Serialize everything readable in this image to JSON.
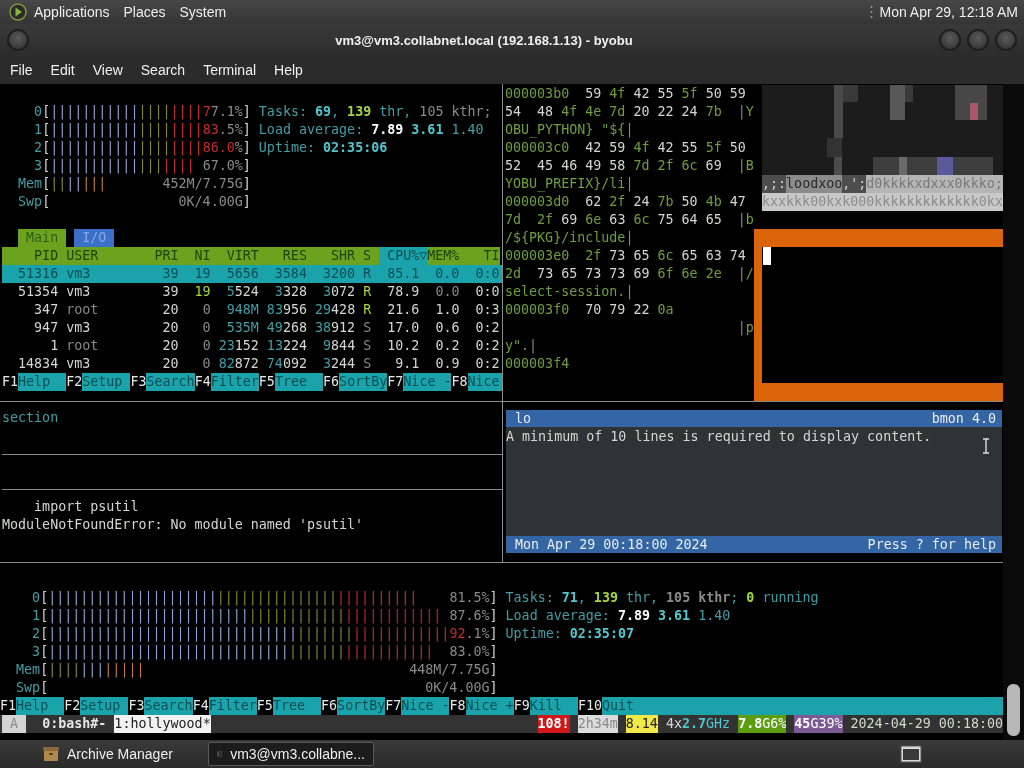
{
  "top_panel": {
    "menus": [
      "Applications",
      "Places",
      "System"
    ],
    "clock": "Mon Apr 29, 12:18 AM"
  },
  "window": {
    "title": "vm3@vm3.collabnet.local (192.168.1.13) - byobu"
  },
  "menu_bar": [
    "File",
    "Edit",
    "View",
    "Search",
    "Terminal",
    "Help"
  ],
  "htop_top": {
    "meters": [
      {
        "segs": [
          {
            "text": "    0",
            "kind": "label"
          },
          {
            "text": "[",
            "kind": "text"
          },
          {
            "text": "|||||||||||",
            "kind": "bar_low"
          },
          {
            "text": "||||",
            "kind": "bar_mid"
          },
          {
            "text": "||||7",
            "kind": "bar_high"
          },
          {
            "text": "7.1%",
            "kind": "dim"
          },
          {
            "text": "]",
            "kind": "text"
          },
          {
            "text": " Tasks:",
            "kind": "label"
          },
          {
            "text": " 69",
            "kind": "num"
          },
          {
            "text": ",",
            "kind": "label"
          },
          {
            "text": " 139",
            "kind": "count"
          },
          {
            "text": " thr,",
            "kind": "label"
          },
          {
            "text": " 105 kthr;",
            "kind": "dim"
          }
        ]
      },
      {
        "segs": [
          {
            "text": "    1",
            "kind": "label"
          },
          {
            "text": "[",
            "kind": "text"
          },
          {
            "text": "|||||||||||",
            "kind": "bar_low"
          },
          {
            "text": "||||",
            "kind": "bar_mid"
          },
          {
            "text": "||||83",
            "kind": "bar_high"
          },
          {
            "text": ".5%",
            "kind": "dim"
          },
          {
            "text": "]",
            "kind": "text"
          },
          {
            "text": " Load average:",
            "kind": "label"
          },
          {
            "text": " 7.89",
            "kind": "strong"
          },
          {
            "text": " 3.61",
            "kind": "num"
          },
          {
            "text": " 1.40",
            "kind": "label"
          }
        ]
      },
      {
        "segs": [
          {
            "text": "    2",
            "kind": "label"
          },
          {
            "text": "[",
            "kind": "text"
          },
          {
            "text": "|||||||||||",
            "kind": "bar_low"
          },
          {
            "text": "||||",
            "kind": "bar_mid"
          },
          {
            "text": "||||86.0",
            "kind": "bar_high"
          },
          {
            "text": "%",
            "kind": "dim"
          },
          {
            "text": "]",
            "kind": "text"
          },
          {
            "text": " Uptime:",
            "kind": "label"
          },
          {
            "text": " 02:35:06",
            "kind": "num"
          }
        ]
      },
      {
        "segs": [
          {
            "text": "    3",
            "kind": "label"
          },
          {
            "text": "[",
            "kind": "text"
          },
          {
            "text": "|||||||||||",
            "kind": "bar_low"
          },
          {
            "text": "|||",
            "kind": "bar_mid"
          },
          {
            "text": "||||",
            "kind": "bar_high"
          },
          {
            "text": " 67.0%",
            "kind": "dim"
          },
          {
            "text": "]",
            "kind": "text"
          }
        ]
      },
      {
        "segs": [
          {
            "text": "  Mem",
            "kind": "label"
          },
          {
            "text": "[",
            "kind": "text"
          },
          {
            "text": "||",
            "kind": "bar_mid"
          },
          {
            "text": "||",
            "kind": "bar_low"
          },
          {
            "text": "|||",
            "kind": "bar_buf"
          },
          {
            "text": "       452M/7.75G",
            "kind": "dim"
          },
          {
            "text": "]",
            "kind": "text"
          }
        ]
      },
      {
        "segs": [
          {
            "text": "  Swp",
            "kind": "label"
          },
          {
            "text": "[",
            "kind": "text"
          },
          {
            "text": "                0K/4.00G",
            "kind": "dim"
          },
          {
            "text": "]",
            "kind": "text"
          }
        ]
      }
    ],
    "tabs": [
      {
        "label": "Main",
        "selected": true
      },
      {
        "label": "I/O",
        "selected": false
      }
    ],
    "header": [
      {
        "text": "    PID USER       PRI  NI  VIRT   RES   SHR S ",
        "kind": "header"
      },
      {
        "text": " CPU%▽",
        "kind": "sorted"
      },
      {
        "text": "MEM%   TI",
        "kind": "header"
      }
    ],
    "processes": [
      {
        "selected": true,
        "segs": [
          {
            "text": "  51316 vm3         39  19  5656  3584  3200 R  85.1  0.0  0:0",
            "kind": "text"
          }
        ]
      },
      {
        "selected": false,
        "segs": [
          {
            "text": "  51354 vm3         39  ",
            "kind": "text"
          },
          {
            "text": "19",
            "kind": "ok"
          },
          {
            "text": "  5",
            "kind": "thousands"
          },
          {
            "text": "524  ",
            "kind": "text"
          },
          {
            "text": "3",
            "kind": "thousands"
          },
          {
            "text": "328  ",
            "kind": "text"
          },
          {
            "text": "3",
            "kind": "thousands"
          },
          {
            "text": "072 ",
            "kind": "text"
          },
          {
            "text": "R",
            "kind": "ok"
          },
          {
            "text": "  78.9  ",
            "kind": "text"
          },
          {
            "text": "0.0",
            "kind": "dim"
          },
          {
            "text": "  0:0",
            "kind": "text"
          }
        ]
      },
      {
        "selected": false,
        "segs": [
          {
            "text": "    347 ",
            "kind": "text"
          },
          {
            "text": "root",
            "kind": "dim"
          },
          {
            "text": "        20   ",
            "kind": "text"
          },
          {
            "text": "0",
            "kind": "dim"
          },
          {
            "text": "  948M",
            "kind": "thousands"
          },
          {
            "text": " 83",
            "kind": "thousands"
          },
          {
            "text": "956 ",
            "kind": "text"
          },
          {
            "text": "29",
            "kind": "thousands"
          },
          {
            "text": "428 ",
            "kind": "text"
          },
          {
            "text": "R",
            "kind": "ok"
          },
          {
            "text": "  21.6  1.0  0:3",
            "kind": "text"
          }
        ]
      },
      {
        "selected": false,
        "segs": [
          {
            "text": "    947 vm3         20   ",
            "kind": "text"
          },
          {
            "text": "0",
            "kind": "dim"
          },
          {
            "text": "  535M",
            "kind": "thousands"
          },
          {
            "text": " 49",
            "kind": "thousands"
          },
          {
            "text": "268 ",
            "kind": "text"
          },
          {
            "text": "38",
            "kind": "thousands"
          },
          {
            "text": "912 ",
            "kind": "text"
          },
          {
            "text": "S",
            "kind": "dim"
          },
          {
            "text": "  17.0  0.6  0:2",
            "kind": "text"
          }
        ]
      },
      {
        "selected": false,
        "segs": [
          {
            "text": "      1 ",
            "kind": "text"
          },
          {
            "text": "root",
            "kind": "dim"
          },
          {
            "text": "        20   ",
            "kind": "text"
          },
          {
            "text": "0",
            "kind": "dim"
          },
          {
            "text": " 23",
            "kind": "thousands"
          },
          {
            "text": "152 ",
            "kind": "text"
          },
          {
            "text": "13",
            "kind": "thousands"
          },
          {
            "text": "224  ",
            "kind": "text"
          },
          {
            "text": "9",
            "kind": "thousands"
          },
          {
            "text": "844 ",
            "kind": "text"
          },
          {
            "text": "S",
            "kind": "dim"
          },
          {
            "text": "  10.2  0.2  0:2",
            "kind": "text"
          }
        ]
      },
      {
        "selected": false,
        "segs": [
          {
            "text": "  14834 vm3         20   ",
            "kind": "text"
          },
          {
            "text": "0",
            "kind": "dim"
          },
          {
            "text": " 82",
            "kind": "thousands"
          },
          {
            "text": "872 ",
            "kind": "text"
          },
          {
            "text": "74",
            "kind": "thousands"
          },
          {
            "text": "092  ",
            "kind": "text"
          },
          {
            "text": "3",
            "kind": "thousands"
          },
          {
            "text": "244 ",
            "kind": "text"
          },
          {
            "text": "S",
            "kind": "dim"
          },
          {
            "text": "   9.1  0.9  0:2",
            "kind": "text"
          }
        ]
      }
    ],
    "keys": [
      {
        "key": "F1",
        "label": "Help"
      },
      {
        "key": "F2",
        "label": "Setup"
      },
      {
        "key": "F3",
        "label": "Search"
      },
      {
        "key": "F4",
        "label": "Filter"
      },
      {
        "key": "F5",
        "label": "Tree"
      },
      {
        "key": "F6",
        "label": "SortBy"
      },
      {
        "key": "F7",
        "label": "Nice -"
      },
      {
        "key": "F8",
        "label": "Nice"
      }
    ]
  },
  "hex_dump": {
    "lines": [
      {
        "segs": [
          {
            "text": "000003b0",
            "kind": "hex"
          },
          {
            "text": "  59 ",
            "kind": "text"
          },
          {
            "text": "4f",
            "kind": "hex"
          },
          {
            "text": " 42 55 ",
            "kind": "text"
          },
          {
            "text": "5f",
            "kind": "hex"
          },
          {
            "text": " 50 59",
            "kind": "text"
          }
        ]
      },
      {
        "segs": [
          {
            "text": "54  48 ",
            "kind": "text"
          },
          {
            "text": "4f 4e 7d",
            "kind": "hex"
          },
          {
            "text": " 20 22 24 ",
            "kind": "text"
          },
          {
            "text": "7b",
            "kind": "hex"
          },
          {
            "text": "  |",
            "kind": "dim"
          },
          {
            "text": "Y",
            "kind": "hex"
          }
        ]
      },
      {
        "segs": [
          {
            "text": "OBU_PYTHON} \"${",
            "kind": "hex"
          },
          {
            "text": "|",
            "kind": "dim"
          }
        ]
      },
      {
        "segs": [
          {
            "text": "000003c0",
            "kind": "hex"
          },
          {
            "text": "  42 59 ",
            "kind": "text"
          },
          {
            "text": "4f",
            "kind": "hex"
          },
          {
            "text": " 42 55 ",
            "kind": "text"
          },
          {
            "text": "5f",
            "kind": "hex"
          },
          {
            "text": " 50",
            "kind": "text"
          }
        ]
      },
      {
        "segs": [
          {
            "text": "52  45 46 49 58 ",
            "kind": "text"
          },
          {
            "text": "7d 2f 6c",
            "kind": "hex"
          },
          {
            "text": " 69",
            "kind": "text"
          },
          {
            "text": "  |",
            "kind": "dim"
          },
          {
            "text": "B",
            "kind": "hex"
          }
        ]
      },
      {
        "segs": [
          {
            "text": "YOBU_PREFIX}/li",
            "kind": "hex"
          },
          {
            "text": "|",
            "kind": "dim"
          }
        ]
      },
      {
        "segs": [
          {
            "text": "000003d0",
            "kind": "hex"
          },
          {
            "text": "  62 ",
            "kind": "text"
          },
          {
            "text": "2f",
            "kind": "hex"
          },
          {
            "text": " 24 ",
            "kind": "text"
          },
          {
            "text": "7b",
            "kind": "hex"
          },
          {
            "text": " 50 ",
            "kind": "text"
          },
          {
            "text": "4b",
            "kind": "hex"
          },
          {
            "text": " 47",
            "kind": "text"
          }
        ]
      },
      {
        "segs": [
          {
            "text": "7d  2f",
            "kind": "hex"
          },
          {
            "text": " 69 ",
            "kind": "text"
          },
          {
            "text": "6e",
            "kind": "hex"
          },
          {
            "text": " 63 ",
            "kind": "text"
          },
          {
            "text": "6c",
            "kind": "hex"
          },
          {
            "text": " 75 64 65",
            "kind": "text"
          },
          {
            "text": "  |",
            "kind": "dim"
          },
          {
            "text": "b",
            "kind": "hex"
          }
        ]
      },
      {
        "segs": [
          {
            "text": "/${PKG}/include",
            "kind": "hex"
          },
          {
            "text": "|",
            "kind": "dim"
          }
        ]
      },
      {
        "segs": [
          {
            "text": "000003e0  2f",
            "kind": "hex"
          },
          {
            "text": " 73 65 ",
            "kind": "text"
          },
          {
            "text": "6c",
            "kind": "hex"
          },
          {
            "text": " 65 63 74",
            "kind": "text"
          }
        ]
      },
      {
        "segs": [
          {
            "text": "2d",
            "kind": "hex"
          },
          {
            "text": "  73 65 73 73 69 ",
            "kind": "text"
          },
          {
            "text": "6f 6e 2e",
            "kind": "hex"
          },
          {
            "text": "  |",
            "kind": "dim"
          },
          {
            "text": "/",
            "kind": "hex"
          }
        ]
      },
      {
        "segs": [
          {
            "text": "select-session.",
            "kind": "hex"
          },
          {
            "text": "|",
            "kind": "dim"
          }
        ]
      },
      {
        "segs": [
          {
            "text": "000003f0",
            "kind": "hex"
          },
          {
            "text": "  70 79 22 ",
            "kind": "text"
          },
          {
            "text": "0a",
            "kind": "hex"
          }
        ]
      },
      {
        "segs": [
          {
            "text": "                             |",
            "kind": "dim"
          },
          {
            "text": "p",
            "kind": "hex"
          }
        ]
      },
      {
        "segs": [
          {
            "text": "y\".",
            "kind": "hex"
          },
          {
            "text": "|",
            "kind": "dim"
          }
        ]
      },
      {
        "segs": [
          {
            "text": "000003f4",
            "kind": "hex"
          }
        ]
      }
    ]
  },
  "ascii_art": {
    "lines": [
      {
        "segs": [
          {
            "text": ",;:",
            "kind": "art_dark"
          },
          {
            "text": "loodxoo",
            "kind": "art_mid"
          },
          {
            "text": ",';",
            "kind": "art_dark"
          },
          {
            "text": "d0kkkkxdxxx0kkko;",
            "kind": "art_light"
          }
        ]
      },
      {
        "segs": [
          {
            "text": "kxxkkk00kxk000kkkkkkkkkkkkk0kx",
            "kind": "art_pale"
          }
        ]
      }
    ]
  },
  "middle_left": {
    "section": "section",
    "lines": [
      "    import psutil",
      "ModuleNotFoundError: No module named 'psutil'"
    ]
  },
  "bmon": {
    "interface": "lo",
    "version": "bmon 4.0",
    "message": "A minimum of 10 lines is required to display content.",
    "date": "Mon Apr 29 00:18:00 2024",
    "help": "Press ? for help"
  },
  "htop_bottom": {
    "meters": [
      {
        "segs": [
          {
            "text": "    0",
            "kind": "label"
          },
          {
            "text": "[",
            "kind": "text"
          },
          {
            "text": "|||||||||||||||||||||",
            "kind": "bar_low"
          },
          {
            "text": "|||||||||||||||",
            "kind": "bar_mid"
          },
          {
            "text": "||||||||||",
            "kind": "bar_high"
          },
          {
            "text": "    81.5%",
            "kind": "dim"
          },
          {
            "text": "]",
            "kind": "text"
          },
          {
            "text": " Tasks:",
            "kind": "label"
          },
          {
            "text": " 71",
            "kind": "num"
          },
          {
            "text": ",",
            "kind": "label"
          },
          {
            "text": " 139",
            "kind": "count"
          },
          {
            "text": " thr,",
            "kind": "label"
          },
          {
            "text": " 105 kthr",
            "kind": "dimstrong"
          },
          {
            "text": ";",
            "kind": "label"
          },
          {
            "text": " 0",
            "kind": "count"
          },
          {
            "text": " running",
            "kind": "label"
          }
        ]
      },
      {
        "segs": [
          {
            "text": "    1",
            "kind": "label"
          },
          {
            "text": "[",
            "kind": "text"
          },
          {
            "text": "|||||||||||||||||||||||||",
            "kind": "bar_low"
          },
          {
            "text": "||||||||||||",
            "kind": "bar_mid"
          },
          {
            "text": "||||||||||||",
            "kind": "bar_high"
          },
          {
            "text": " 87.6%",
            "kind": "dim"
          },
          {
            "text": "]",
            "kind": "text"
          },
          {
            "text": " Load average:",
            "kind": "label"
          },
          {
            "text": " 7.89",
            "kind": "strong"
          },
          {
            "text": " 3.61",
            "kind": "num"
          },
          {
            "text": " 1.40",
            "kind": "label"
          }
        ]
      },
      {
        "segs": [
          {
            "text": "    2",
            "kind": "label"
          },
          {
            "text": "[",
            "kind": "text"
          },
          {
            "text": "|||||||||||||||||||||||||||||||",
            "kind": "bar_low"
          },
          {
            "text": "|||||||",
            "kind": "bar_mid"
          },
          {
            "text": "||||||||||||92",
            "kind": "bar_high"
          },
          {
            "text": ".1%",
            "kind": "dim"
          },
          {
            "text": "]",
            "kind": "text"
          },
          {
            "text": " Uptime:",
            "kind": "label"
          },
          {
            "text": " 02:35:07",
            "kind": "num"
          }
        ]
      },
      {
        "segs": [
          {
            "text": "    3",
            "kind": "label"
          },
          {
            "text": "[",
            "kind": "text"
          },
          {
            "text": "||||||||||||||||||||||||||||||",
            "kind": "bar_low"
          },
          {
            "text": "|||||||",
            "kind": "bar_mid"
          },
          {
            "text": "|||||||||||",
            "kind": "bar_high"
          },
          {
            "text": "  83.0%",
            "kind": "dim"
          },
          {
            "text": "]",
            "kind": "text"
          }
        ]
      },
      {
        "segs": [
          {
            "text": "  Mem",
            "kind": "label"
          },
          {
            "text": "[",
            "kind": "text"
          },
          {
            "text": "||||",
            "kind": "bar_mid"
          },
          {
            "text": "|||",
            "kind": "bar_low"
          },
          {
            "text": "|||||",
            "kind": "bar_buf"
          },
          {
            "text": "                                 448M/7.75G",
            "kind": "dim"
          },
          {
            "text": "]",
            "kind": "text"
          }
        ]
      },
      {
        "segs": [
          {
            "text": "  Swp",
            "kind": "label"
          },
          {
            "text": "[",
            "kind": "text"
          },
          {
            "text": "                                               0K/4.00G",
            "kind": "dim"
          },
          {
            "text": "]",
            "kind": "text"
          }
        ]
      }
    ],
    "keys": [
      {
        "key": "F1",
        "label": "Help"
      },
      {
        "key": "F2",
        "label": "Setup"
      },
      {
        "key": "F3",
        "label": "Search"
      },
      {
        "key": "F4",
        "label": "Filter"
      },
      {
        "key": "F5",
        "label": "Tree"
      },
      {
        "key": "F6",
        "label": "SortBy"
      },
      {
        "key": "F7",
        "label": "Nice -"
      },
      {
        "key": "F8",
        "label": "Nice +"
      },
      {
        "key": "F9",
        "label": "Kill"
      },
      {
        "key": "F10",
        "label": "Quit"
      }
    ]
  },
  "byobu_status": {
    "left": [
      {
        "text": " A ",
        "kind": "mode"
      },
      {
        "text": "  0:bash#- ",
        "kind": "window"
      },
      {
        "text": "1:hollywood*",
        "kind": "current_window"
      }
    ],
    "right": [
      {
        "text": "108!",
        "kind": "alert"
      },
      {
        "text": "2h34m",
        "kind": "uptime"
      },
      {
        "text": "8.14",
        "kind": "load"
      },
      {
        "text": " 4x",
        "kind": "text"
      },
      {
        "text": "2.7",
        "kind": "freq"
      },
      {
        "text": "GHz ",
        "kind": "freq_unit"
      },
      {
        "text": "7.8",
        "kind": "mem"
      },
      {
        "text": "G6%",
        "kind": "mem_unit"
      },
      {
        "text": "45",
        "kind": "disk"
      },
      {
        "text": "G39%",
        "kind": "disk_unit"
      },
      {
        "text": " 2024-04-29 00:18:00",
        "kind": "text"
      }
    ]
  },
  "taskbar": {
    "items": [
      {
        "kind": "archive",
        "label": "Archive Manager",
        "selected": false
      },
      {
        "kind": "terminal",
        "label": "vm3@vm3.collabne...",
        "selected": true
      }
    ]
  }
}
